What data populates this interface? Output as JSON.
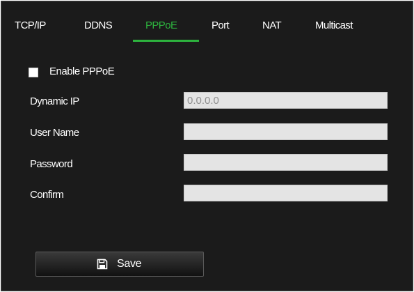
{
  "tabs": [
    {
      "label": "TCP/IP"
    },
    {
      "label": "DDNS"
    },
    {
      "label": "PPPoE",
      "active": true
    },
    {
      "label": "Port"
    },
    {
      "label": "NAT"
    },
    {
      "label": "Multicast"
    }
  ],
  "pppoe": {
    "enable_label": "Enable PPPoE",
    "enabled": false,
    "fields": [
      {
        "label": "Dynamic IP",
        "value": "0.0.0.0",
        "readonly": true
      },
      {
        "label": "User Name",
        "value": ""
      },
      {
        "label": "Password",
        "value": ""
      },
      {
        "label": "Confirm",
        "value": ""
      }
    ]
  },
  "actions": {
    "save_label": "Save",
    "save_icon": "floppy-disk-icon"
  },
  "colors": {
    "accent": "#2db33e",
    "background": "#1b1b1b",
    "field_bg": "#e4e4e4"
  }
}
